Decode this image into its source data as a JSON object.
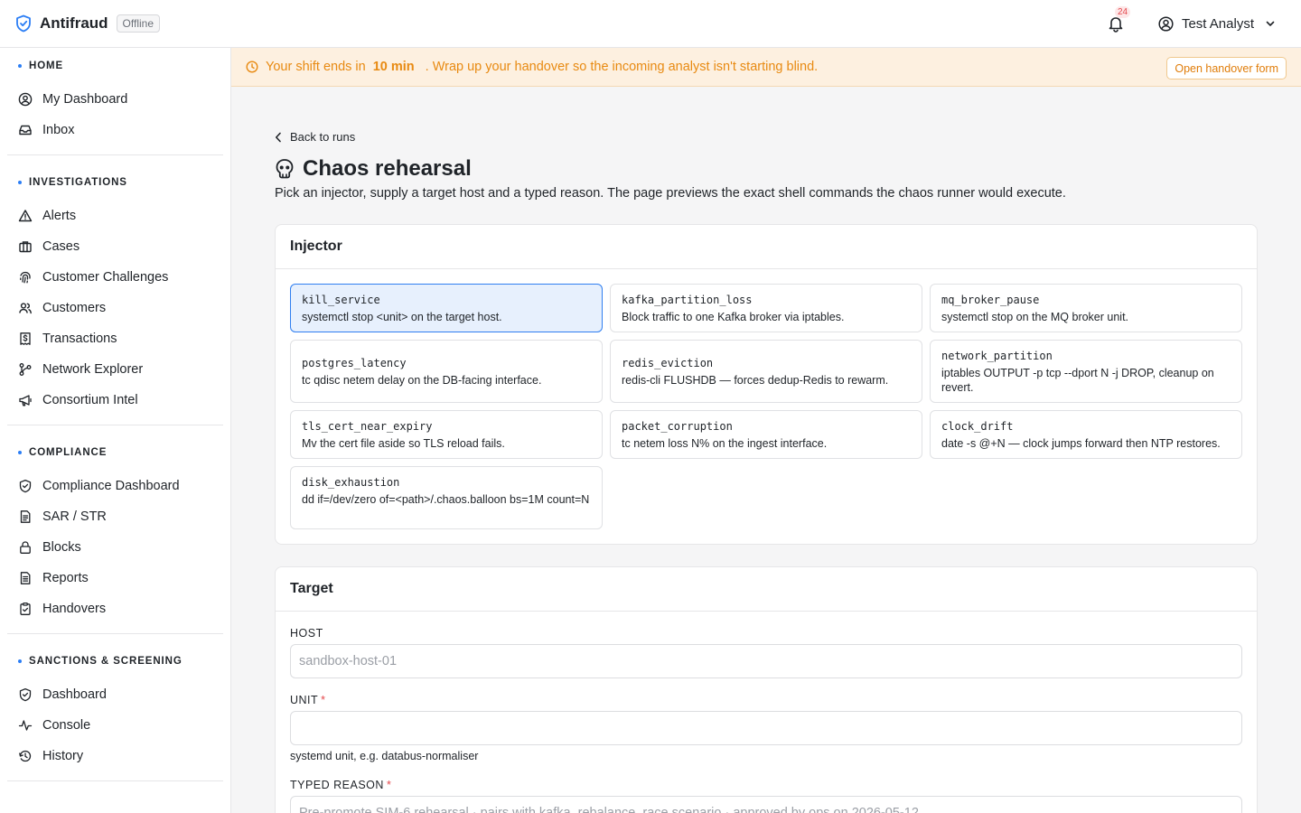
{
  "app": {
    "name": "Antifraud",
    "status_badge": "Offline"
  },
  "header": {
    "notifications_count": "24",
    "user_name": "Test Analyst"
  },
  "sidebar": {
    "sections": [
      {
        "title": "HOME",
        "items": [
          {
            "label": "My Dashboard",
            "icon": "user-circle-icon"
          },
          {
            "label": "Inbox",
            "icon": "inbox-icon"
          }
        ]
      },
      {
        "title": "INVESTIGATIONS",
        "items": [
          {
            "label": "Alerts",
            "icon": "warning-triangle-icon"
          },
          {
            "label": "Cases",
            "icon": "briefcase-icon"
          },
          {
            "label": "Customer Challenges",
            "icon": "fingerprint-icon"
          },
          {
            "label": "Customers",
            "icon": "users-icon"
          },
          {
            "label": "Transactions",
            "icon": "receipt-dollar-icon"
          },
          {
            "label": "Network Explorer",
            "icon": "network-icon"
          },
          {
            "label": "Consortium Intel",
            "icon": "megaphone-icon"
          }
        ]
      },
      {
        "title": "COMPLIANCE",
        "items": [
          {
            "label": "Compliance Dashboard",
            "icon": "shield-check-icon"
          },
          {
            "label": "SAR / STR",
            "icon": "document-icon"
          },
          {
            "label": "Blocks",
            "icon": "lock-icon"
          },
          {
            "label": "Reports",
            "icon": "report-icon"
          },
          {
            "label": "Handovers",
            "icon": "clipboard-check-icon"
          }
        ]
      },
      {
        "title": "SANCTIONS & SCREENING",
        "items": [
          {
            "label": "Dashboard",
            "icon": "shield-check-icon"
          },
          {
            "label": "Console",
            "icon": "activity-icon"
          },
          {
            "label": "History",
            "icon": "history-icon"
          }
        ]
      }
    ]
  },
  "banner": {
    "prefix": "Your shift ends in",
    "highlight": "10 min",
    "suffix": ". Wrap up your handover so the incoming analyst isn't starting blind.",
    "button_label": "Open handover form"
  },
  "page": {
    "back_label": "Back to runs",
    "title": "Chaos rehearsal",
    "subtitle": "Pick an injector, supply a target host and a typed reason. The page previews the exact shell commands the chaos runner would execute."
  },
  "injector": {
    "heading": "Injector",
    "selected": "kill_service",
    "items": [
      {
        "name": "kill_service",
        "desc": "systemctl stop <unit> on the target host."
      },
      {
        "name": "kafka_partition_loss",
        "desc": "Block traffic to one Kafka broker via iptables."
      },
      {
        "name": "mq_broker_pause",
        "desc": "systemctl stop on the MQ broker unit."
      },
      {
        "name": "postgres_latency",
        "desc": "tc qdisc netem delay on the DB-facing interface."
      },
      {
        "name": "redis_eviction",
        "desc": "redis-cli FLUSHDB — forces dedup-Redis to rewarm."
      },
      {
        "name": "network_partition",
        "desc": "iptables OUTPUT -p tcp --dport N -j DROP, cleanup on revert."
      },
      {
        "name": "tls_cert_near_expiry",
        "desc": "Mv the cert file aside so TLS reload fails."
      },
      {
        "name": "packet_corruption",
        "desc": "tc netem loss N% on the ingest interface."
      },
      {
        "name": "clock_drift",
        "desc": "date -s @+N — clock jumps forward then NTP restores."
      },
      {
        "name": "disk_exhaustion",
        "desc": "dd if=/dev/zero of=<path>/.chaos.balloon bs=1M count=N"
      }
    ]
  },
  "target": {
    "heading": "Target",
    "host_label": "HOST",
    "host_placeholder": "sandbox-host-01",
    "unit_label": "UNIT",
    "unit_required": "*",
    "unit_value": "",
    "unit_help": "systemd unit, e.g. databus-normaliser",
    "reason_label": "TYPED REASON",
    "reason_required": "*",
    "reason_placeholder": "Pre-promote SIM-6 rehearsal · pairs with kafka_rebalance_race scenario · approved by ops on 2026-05-12"
  },
  "colors": {
    "accent": "#2f7ef0",
    "warning": "#e88a12",
    "required": "#e5484d"
  }
}
